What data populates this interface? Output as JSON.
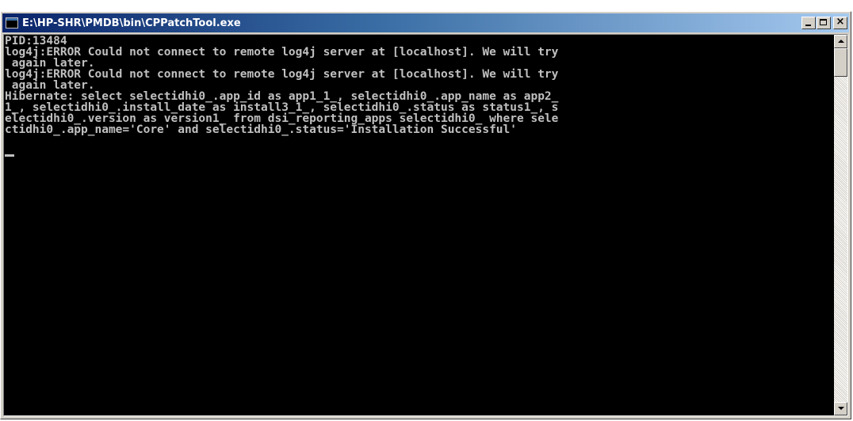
{
  "window": {
    "title": "E:\\HP-SHR\\PMDB\\bin\\CPPatchTool.exe",
    "icon": "console-icon",
    "buttons": {
      "minimize": "minimize-icon",
      "maximize": "maximize-icon",
      "close": "close-icon",
      "close_glyph": "×"
    }
  },
  "console": {
    "lines": [
      "PID:13484",
      "log4j:ERROR Could not connect to remote log4j server at [localhost]. We will try",
      " again later.",
      "log4j:ERROR Could not connect to remote log4j server at [localhost]. We will try",
      " again later.",
      "Hibernate: select selectidhi0_.app_id as app1_1_, selectidhi0_.app_name as app2_",
      "1_, selectidhi0_.install_date as install3_1_, selectidhi0_.status as status1_, s",
      "electidhi0_.version as version1_ from dsi_reporting_apps selectidhi0_ where sele",
      "ctidhi0_.app_name='Core' and selectidhi0_.status='Installation Successful'"
    ],
    "foreground": "#c0c0c0",
    "background": "#000000"
  },
  "colors": {
    "titlebar_start": "#0a246a",
    "titlebar_end": "#a6caf0",
    "chrome": "#d4d0c8"
  }
}
